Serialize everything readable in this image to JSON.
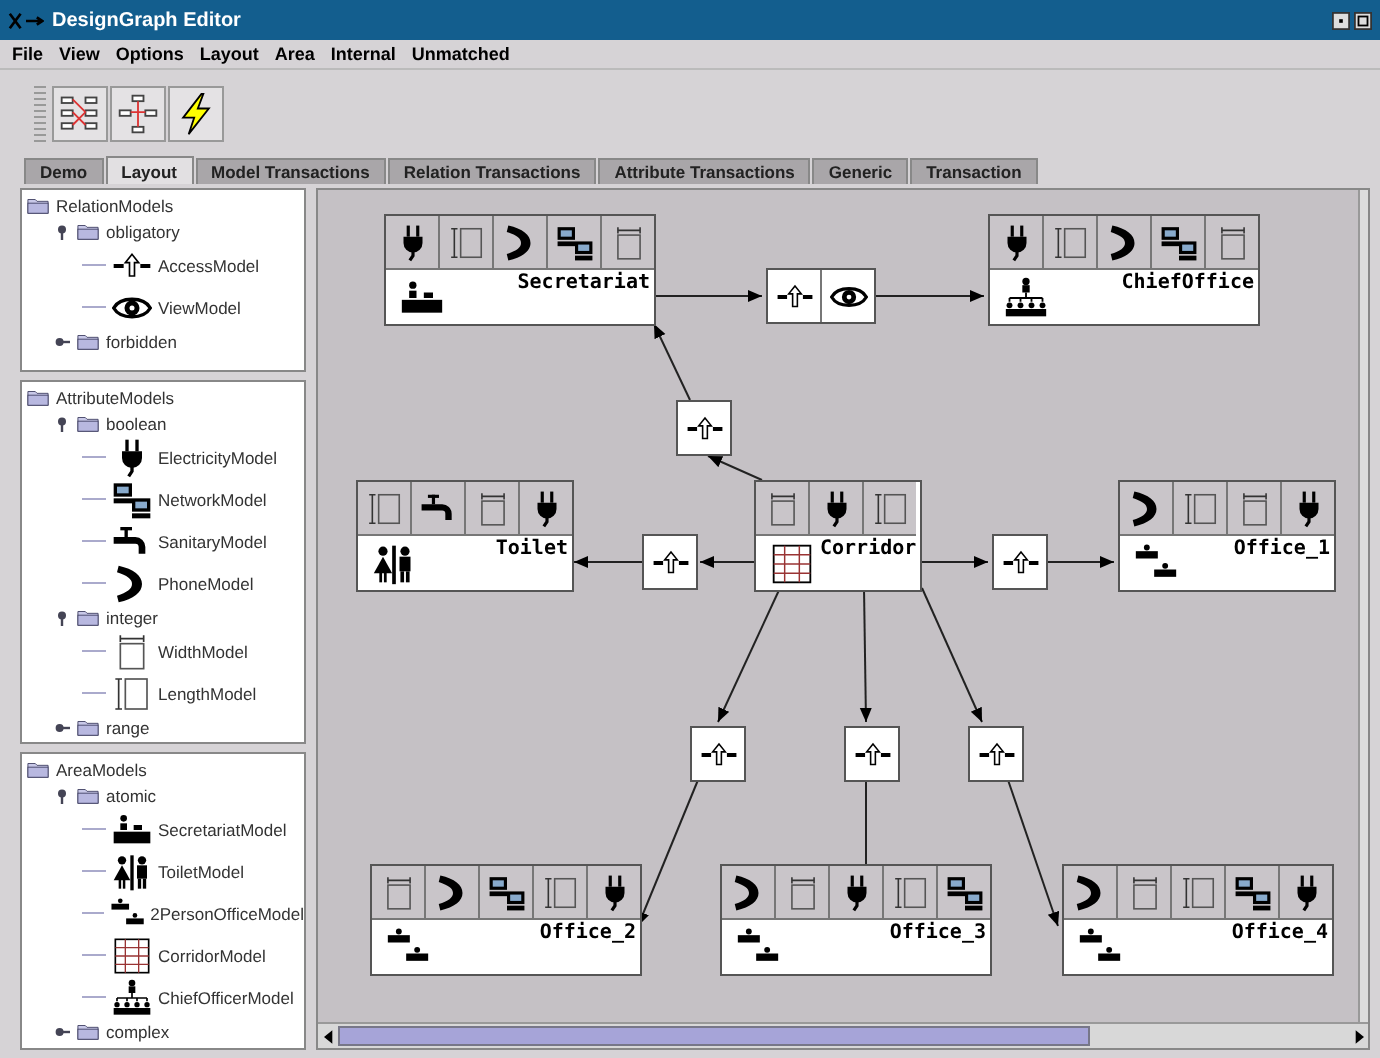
{
  "window": {
    "title": "DesignGraph Editor"
  },
  "menu": [
    "File",
    "View",
    "Options",
    "Layout",
    "Area",
    "Internal",
    "Unmatched"
  ],
  "tabs": [
    {
      "label": "Demo",
      "selected": false
    },
    {
      "label": "Layout",
      "selected": true
    },
    {
      "label": "Model Transactions",
      "selected": false
    },
    {
      "label": "Relation Transactions",
      "selected": false
    },
    {
      "label": "Attribute Transactions",
      "selected": false
    },
    {
      "label": "Generic",
      "selected": false
    },
    {
      "label": "Transaction",
      "selected": false
    }
  ],
  "trees": [
    {
      "label": "RelationModels",
      "kind": "folder",
      "children": [
        {
          "label": "obligatory",
          "kind": "folder",
          "expanded": true,
          "children": [
            {
              "label": "AccessModel",
              "kind": "access"
            },
            {
              "label": "ViewModel",
              "kind": "view"
            }
          ]
        },
        {
          "label": "forbidden",
          "kind": "folder",
          "expanded": false
        }
      ]
    },
    {
      "label": "AttributeModels",
      "kind": "folder",
      "children": [
        {
          "label": "boolean",
          "kind": "folder",
          "expanded": true,
          "children": [
            {
              "label": "ElectricityModel",
              "kind": "electricity"
            },
            {
              "label": "NetworkModel",
              "kind": "network"
            },
            {
              "label": "SanitaryModel",
              "kind": "sanitary"
            },
            {
              "label": "PhoneModel",
              "kind": "phone"
            }
          ]
        },
        {
          "label": "integer",
          "kind": "folder",
          "expanded": true,
          "children": [
            {
              "label": "WidthModel",
              "kind": "width"
            },
            {
              "label": "LengthModel",
              "kind": "length"
            }
          ]
        },
        {
          "label": "range",
          "kind": "folder",
          "expanded": false
        }
      ]
    },
    {
      "label": "AreaModels",
      "kind": "folder",
      "children": [
        {
          "label": "atomic",
          "kind": "folder",
          "expanded": true,
          "children": [
            {
              "label": "SecretariatModel",
              "kind": "secretariat"
            },
            {
              "label": "ToiletModel",
              "kind": "toilet"
            },
            {
              "label": "2PersonOfficeModel",
              "kind": "office"
            },
            {
              "label": "CorridorModel",
              "kind": "corridor"
            },
            {
              "label": "ChiefOfficerModel",
              "kind": "chief"
            }
          ]
        },
        {
          "label": "complex",
          "kind": "folder",
          "expanded": false
        }
      ]
    }
  ],
  "graph": {
    "nodes": [
      {
        "kind": "room",
        "label": "Secretariat",
        "area": {
          "kind": "secretariat"
        },
        "attributes": [
          {
            "kind": "electricity"
          },
          {
            "kind": "length"
          },
          {
            "kind": "phone"
          },
          {
            "kind": "network"
          },
          {
            "kind": "width"
          }
        ]
      },
      {
        "kind": "relation",
        "items": [
          {
            "kind": "access"
          },
          {
            "kind": "view"
          }
        ]
      },
      {
        "kind": "room",
        "label": "ChiefOffice",
        "area": {
          "kind": "chief"
        },
        "attributes": [
          {
            "kind": "electricity"
          },
          {
            "kind": "length"
          },
          {
            "kind": "phone"
          },
          {
            "kind": "network"
          },
          {
            "kind": "width"
          }
        ]
      },
      {
        "kind": "relation",
        "items": [
          {
            "kind": "access"
          }
        ]
      },
      {
        "kind": "room",
        "label": "Toilet",
        "area": {
          "kind": "toilet"
        },
        "attributes": [
          {
            "kind": "length"
          },
          {
            "kind": "sanitary"
          },
          {
            "kind": "width"
          },
          {
            "kind": "electricity"
          }
        ]
      },
      {
        "kind": "relation",
        "items": [
          {
            "kind": "access"
          }
        ]
      },
      {
        "kind": "room",
        "label": "Corridor",
        "area": {
          "kind": "corridor"
        },
        "attributes": [
          {
            "kind": "width"
          },
          {
            "kind": "electricity"
          },
          {
            "kind": "length"
          }
        ]
      },
      {
        "kind": "relation",
        "items": [
          {
            "kind": "access"
          }
        ]
      },
      {
        "kind": "room",
        "label": "Office_1",
        "area": {
          "kind": "office"
        },
        "attributes": [
          {
            "kind": "phone"
          },
          {
            "kind": "length"
          },
          {
            "kind": "width"
          },
          {
            "kind": "electricity"
          }
        ]
      },
      {
        "kind": "relation",
        "items": [
          {
            "kind": "access"
          }
        ]
      },
      {
        "kind": "relation",
        "items": [
          {
            "kind": "access"
          }
        ]
      },
      {
        "kind": "relation",
        "items": [
          {
            "kind": "access"
          }
        ]
      },
      {
        "kind": "room",
        "label": "Office_2",
        "area": {
          "kind": "office"
        },
        "attributes": [
          {
            "kind": "width"
          },
          {
            "kind": "phone"
          },
          {
            "kind": "network"
          },
          {
            "kind": "length"
          },
          {
            "kind": "electricity"
          }
        ]
      },
      {
        "kind": "room",
        "label": "Office_3",
        "area": {
          "kind": "office"
        },
        "attributes": [
          {
            "kind": "phone"
          },
          {
            "kind": "width"
          },
          {
            "kind": "electricity"
          },
          {
            "kind": "length"
          },
          {
            "kind": "network"
          }
        ]
      },
      {
        "kind": "room",
        "label": "Office_4",
        "area": {
          "kind": "office"
        },
        "attributes": [
          {
            "kind": "phone"
          },
          {
            "kind": "width"
          },
          {
            "kind": "length"
          },
          {
            "kind": "network"
          },
          {
            "kind": "electricity"
          }
        ]
      }
    ]
  }
}
